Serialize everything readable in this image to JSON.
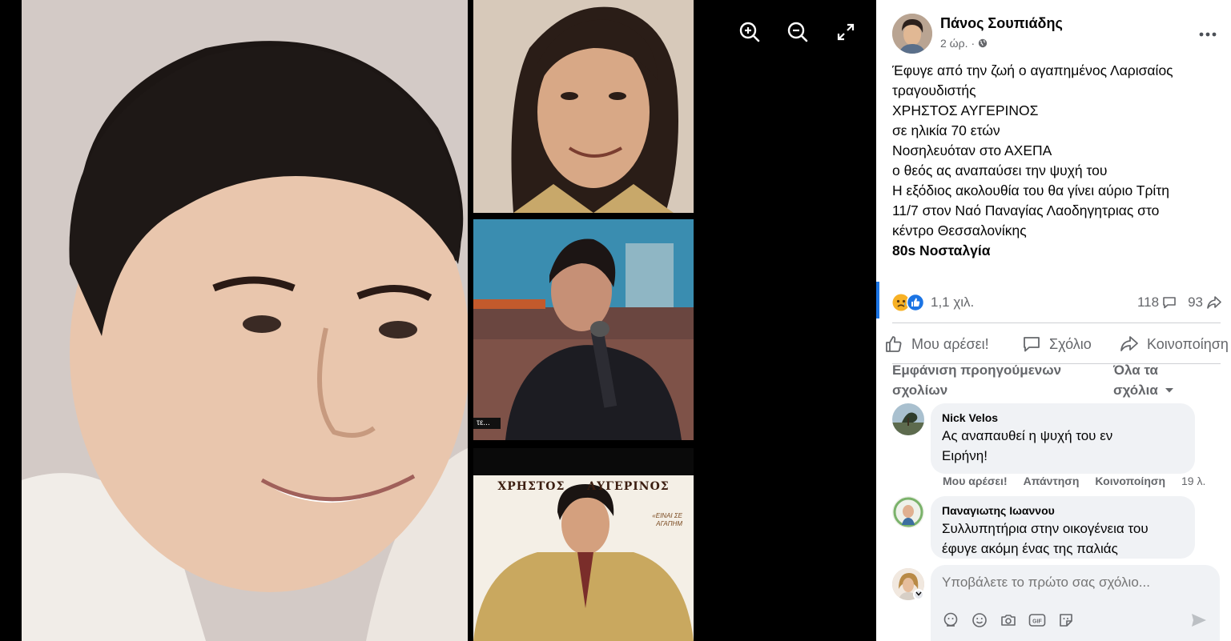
{
  "viewer": {
    "toolbar": {
      "zoom_in_icon": "zoom-in-icon",
      "zoom_out_icon": "zoom-out-icon",
      "fullscreen_icon": "expand-icon"
    },
    "album_cover": {
      "title": "ΧΡΗΣΤΟΣ ΑΥΓΕΡΙΝΟΣ",
      "subtitle": "«ΕΙΝΑΙ ΣΕ ΑΓΑΠΗΜ"
    },
    "tv_tag": "τε..."
  },
  "post": {
    "author": "Πάνος Σουπιάδης",
    "time": "2 ώρ.",
    "audience_icon": "globe-icon",
    "lines": [
      "Έφυγε από την ζωή ο αγαπημένος Λαρισαίος",
      "τραγουδιστής",
      "ΧΡΗΣΤΟΣ ΑΥΓΕΡΙΝΟΣ",
      "σε ηλικία 70 ετών",
      "Νοσηλευόταν στο ΑΧΕΠΑ",
      "ο θεός ας αναπαύσει την ψυχή του",
      "Η εξόδιος ακολουθία του θα γίνει αύριο Τρίτη",
      "11/7 στον Ναό Παναγίας Λαοδηγητριας στο",
      "κέντρο Θεσσαλονίκης"
    ],
    "tag": "80s Νοσταλγία",
    "reactions": {
      "count": "1,1 χιλ.",
      "comments": "118",
      "shares": "93"
    },
    "actions": {
      "like": "Μου αρέσει!",
      "comment": "Σχόλιο",
      "share": "Κοινοποίηση"
    }
  },
  "comments_header": {
    "prev_line1": "Εμφάνιση προηγούμενων",
    "prev_line2": "σχολίων",
    "filter_line1": "Όλα τα",
    "filter_line2": "σχόλια"
  },
  "comments": [
    {
      "name": "Nick Velos",
      "lines": [
        "Ας αναπαυθεί η ψυχή του εν",
        "Ειρήνη!"
      ],
      "like": "Μου αρέσει!",
      "reply": "Απάντηση",
      "share": "Κοινοποίηση",
      "time": "19 λ."
    },
    {
      "name": "Παναγιωτης Ιωαννου",
      "lines": [
        "Συλλυπητήρια στην οικογένεια του",
        "έφυγε ακόμη ένας της παλιάς"
      ]
    }
  ],
  "composer": {
    "placeholder": "Υποβάλετε το πρώτο σας σχόλιο..."
  },
  "colors": {
    "accent": "#1b74e4",
    "secondary_text": "#65676b",
    "bubble": "#f0f2f5"
  }
}
